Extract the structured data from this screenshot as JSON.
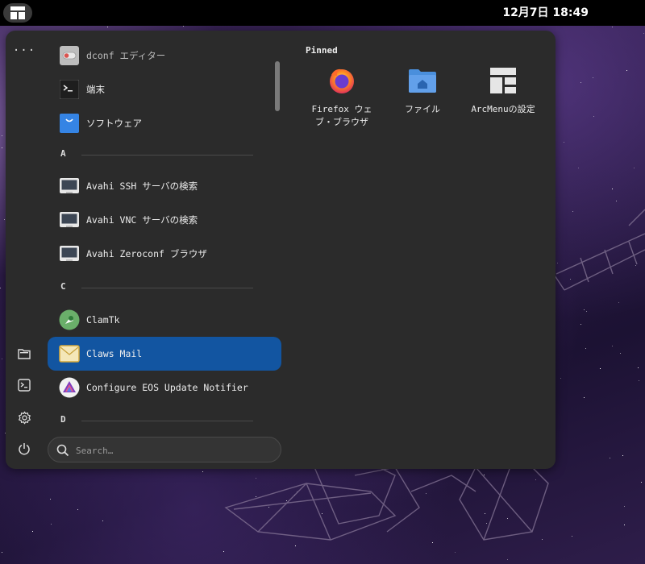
{
  "topbar": {
    "clock": "12月7日  18:49"
  },
  "menu": {
    "more_label": "···",
    "apps": [
      {
        "label": "dconf エディター",
        "icon": "dconf-editor-icon",
        "faded": true
      },
      {
        "label": "端末",
        "icon": "terminal-icon"
      },
      {
        "label": "ソフトウェア",
        "icon": "software-bag-icon"
      }
    ],
    "sections": [
      {
        "letter": "A",
        "apps": [
          {
            "label": "Avahi SSH サーバの検索",
            "icon": "monitor-icon"
          },
          {
            "label": "Avahi VNC サーバの検索",
            "icon": "monitor-icon"
          },
          {
            "label": "Avahi Zeroconf ブラウザ",
            "icon": "monitor-icon"
          }
        ]
      },
      {
        "letter": "C",
        "apps": [
          {
            "label": "ClamTk",
            "icon": "clamtk-icon"
          },
          {
            "label": "Claws Mail",
            "icon": "envelope-icon",
            "active": true
          },
          {
            "label": "Configure EOS Update Notifier",
            "icon": "eos-icon"
          }
        ]
      },
      {
        "letter": "D",
        "apps": []
      }
    ],
    "search": {
      "placeholder": "Search…"
    },
    "pinned": {
      "title": "Pinned",
      "items": [
        {
          "label": "Firefox ウェブ・ブラウザ",
          "icon": "firefox-icon"
        },
        {
          "label": "ファイル",
          "icon": "folder-home-icon"
        },
        {
          "label": "ArcMenuの設定",
          "icon": "arcmenu-layout-icon"
        }
      ]
    },
    "side_icons": [
      "folder-icon",
      "terminal-small-icon",
      "gear-icon",
      "power-icon"
    ]
  },
  "colors": {
    "panel": "#2b2b2b",
    "accent": "#1255a1",
    "topbar": "#000000"
  }
}
